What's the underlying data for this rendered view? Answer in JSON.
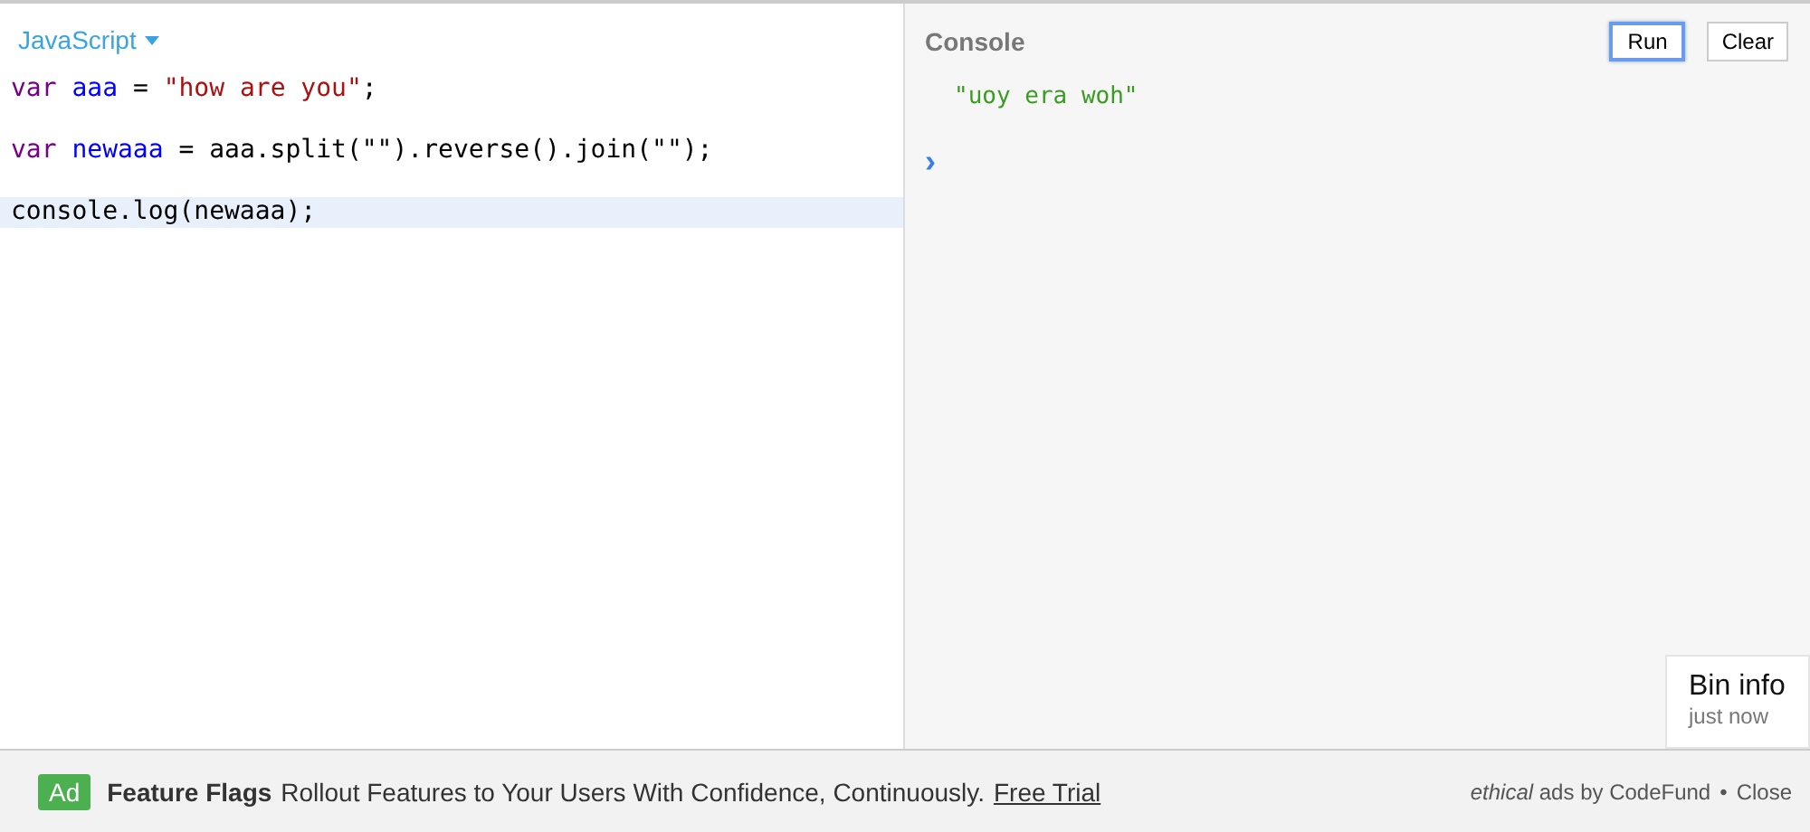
{
  "editor": {
    "language": "JavaScript",
    "lines": [
      {
        "active": false,
        "tokens": [
          {
            "kind": "keyword",
            "text": "var "
          },
          {
            "kind": "def",
            "text": "aaa"
          },
          {
            "kind": "plain",
            "text": " = "
          },
          {
            "kind": "string",
            "text": "\"how are you\""
          },
          {
            "kind": "plain",
            "text": ";"
          }
        ]
      },
      {
        "active": false,
        "tokens": [
          {
            "kind": "keyword",
            "text": "var "
          },
          {
            "kind": "def",
            "text": "newaaa"
          },
          {
            "kind": "plain",
            "text": " = aaa.split(\"\").reverse().join(\"\");"
          }
        ]
      },
      {
        "active": true,
        "tokens": [
          {
            "kind": "plain",
            "text": "console.log(newaaa);"
          }
        ]
      }
    ]
  },
  "console": {
    "title": "Console",
    "buttons": [
      {
        "label": "Run",
        "focused": true
      },
      {
        "label": "Clear",
        "focused": false
      }
    ],
    "output": [
      "\"uoy era woh\""
    ],
    "prompt": "›"
  },
  "bin_info": {
    "title": "Bin info",
    "time": "just now"
  },
  "ad": {
    "badge": "Ad",
    "headline": "Feature Flags",
    "text": "Rollout Features to Your Users With Confidence, Continuously.",
    "link": "Free Trial",
    "credit": "*ethical* ads by CodeFund",
    "separator": "•",
    "close": "Close"
  }
}
